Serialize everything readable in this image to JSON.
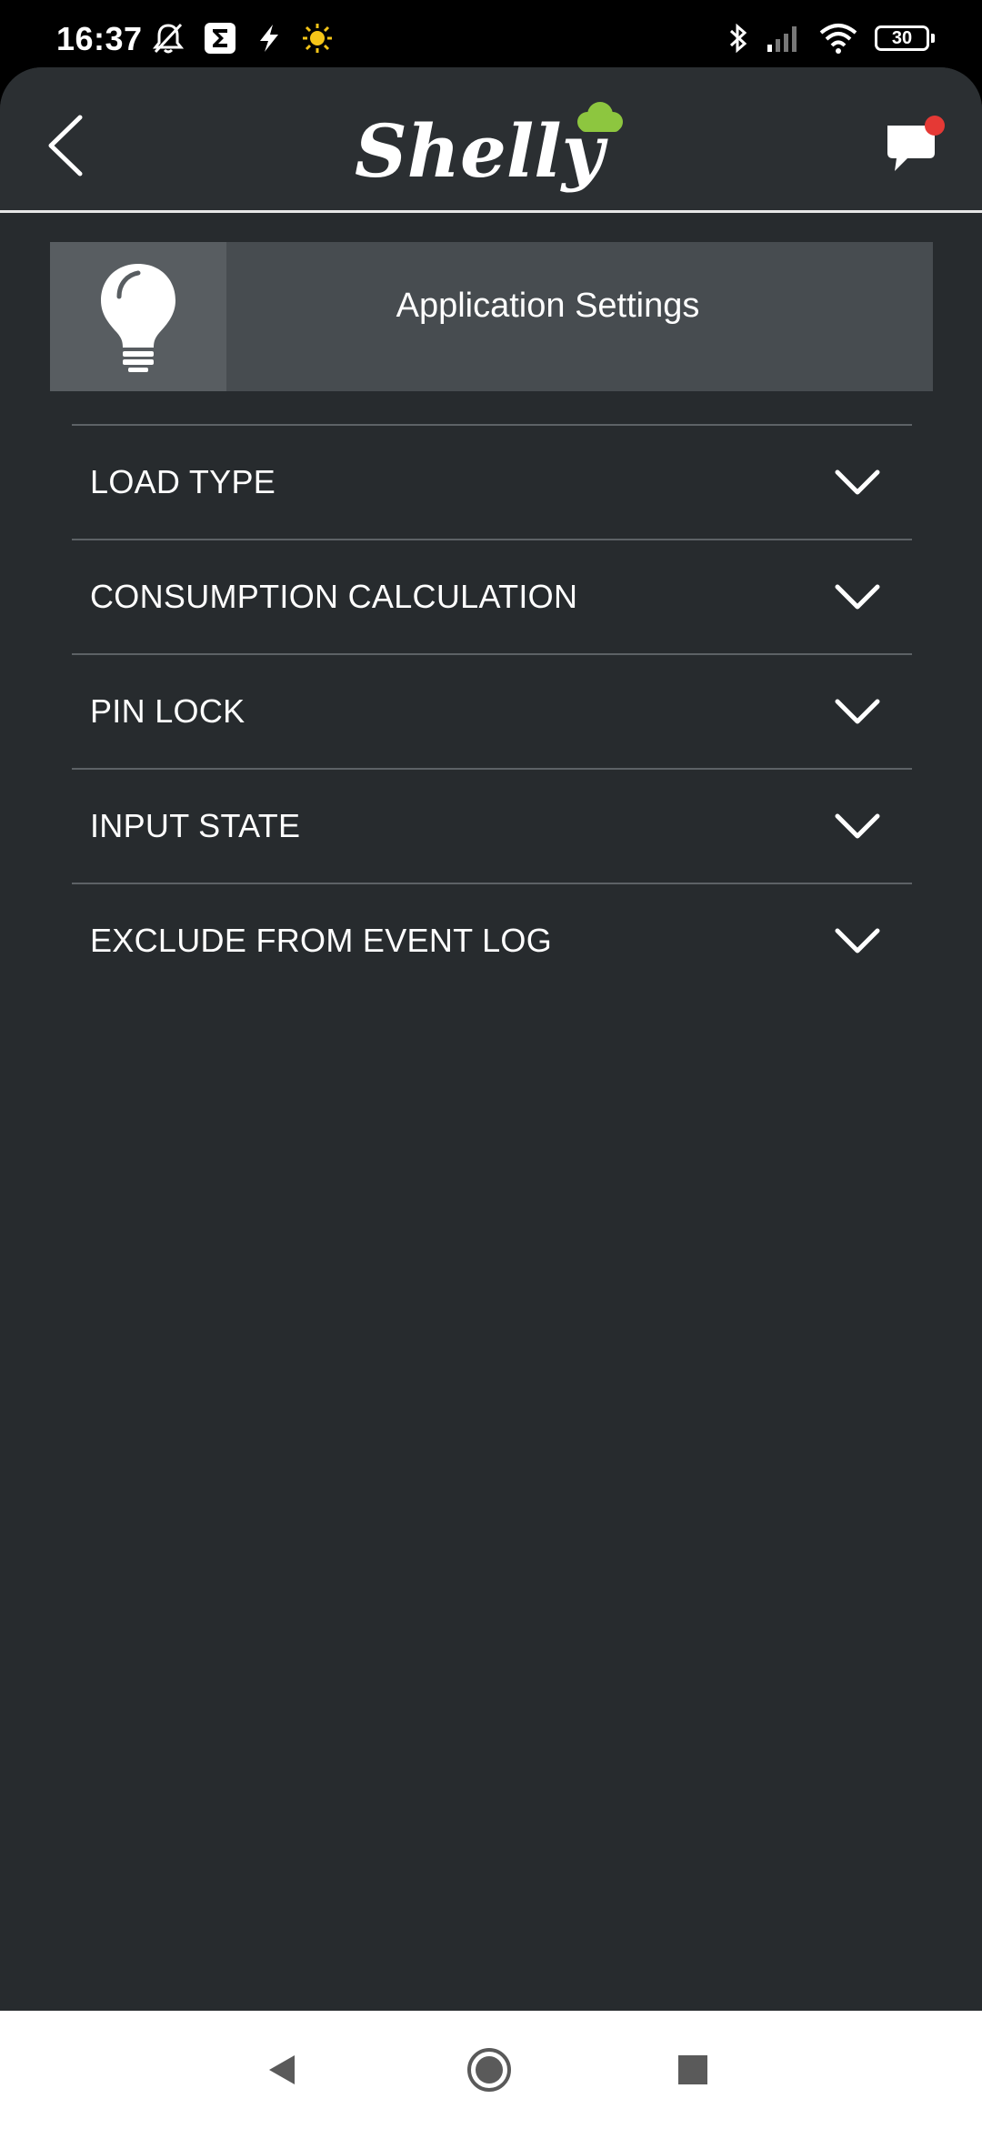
{
  "status_bar": {
    "time": "16:37",
    "battery": "30",
    "left_icons": [
      "bell-off-icon",
      "sigma-app-icon",
      "flash-icon",
      "sun-icon"
    ],
    "right_icons": [
      "bluetooth-icon",
      "cell-signal-icon",
      "wifi-icon",
      "battery-icon"
    ]
  },
  "header": {
    "logo_text": "Shelly",
    "back_icon": "chevron-left-icon",
    "notification_icon": "chat-bubble-icon",
    "notification_dot_color": "#e53935",
    "logo_cloud_color": "#8dc63f"
  },
  "settings": {
    "title": "Application Settings",
    "icon": "lightbulb-icon"
  },
  "accordion": {
    "items": [
      {
        "label": "LOAD TYPE"
      },
      {
        "label": "CONSUMPTION CALCULATION"
      },
      {
        "label": "PIN LOCK"
      },
      {
        "label": "INPUT STATE"
      },
      {
        "label": "EXCLUDE FROM EVENT LOG"
      }
    ]
  },
  "nav_bar": {
    "buttons": [
      "back-triangle-icon",
      "home-circle-icon",
      "recents-square-icon"
    ]
  },
  "colors": {
    "background": "#272b2e",
    "panel": "#474c50",
    "panel_icon_box": "#585d61",
    "text": "#ffffff"
  }
}
